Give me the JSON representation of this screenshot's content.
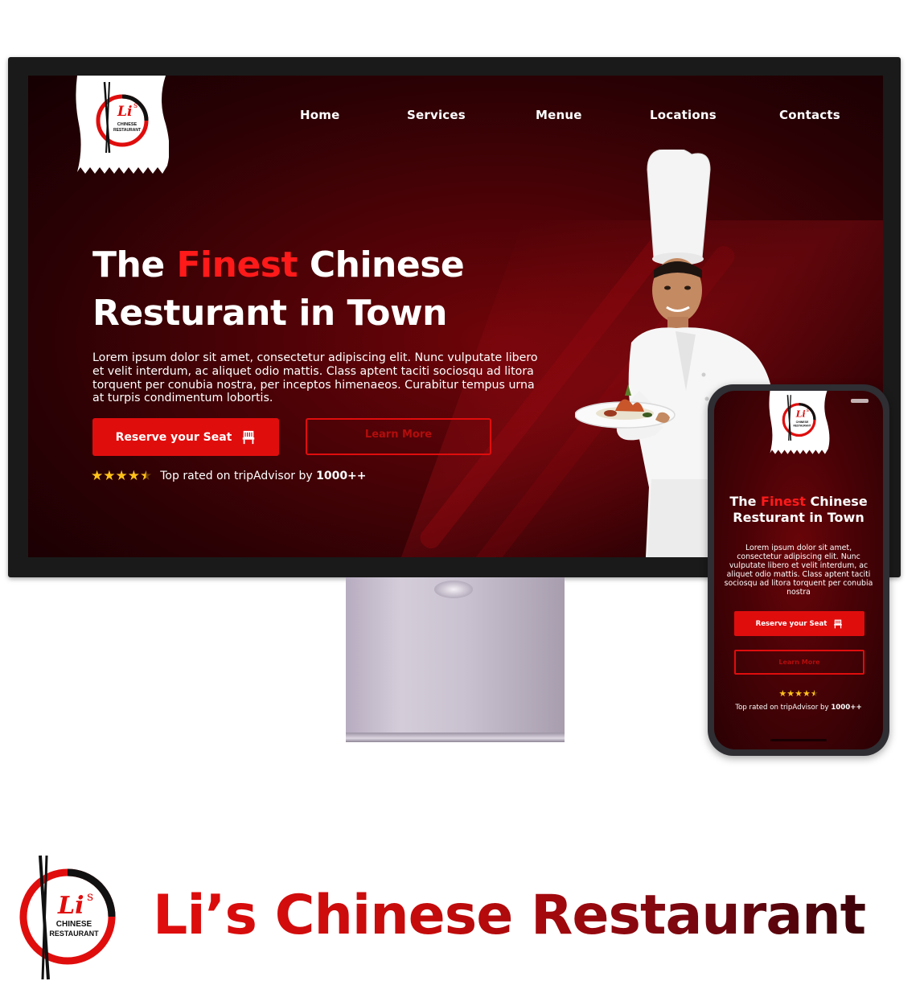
{
  "colors": {
    "accent": "#e00d0d",
    "bg_dark": "#2a0104",
    "bg_mid": "#6e0409",
    "star": "#ffc21a"
  },
  "logo": {
    "initials": "Li",
    "apostrophe": "'s",
    "line1": "CHINESE",
    "line2": "RESTAURANT"
  },
  "nav": {
    "items": [
      "Home",
      "Services",
      "Menue",
      "Locations",
      "Contacts"
    ]
  },
  "hero": {
    "title_prefix": "The ",
    "title_highlight": "Finest",
    "title_line1_suffix": " Chinese",
    "title_line2": "Resturant in Town",
    "description": "Lorem ipsum dolor sit amet, consectetur adipiscing elit. Nunc vulputate libero et velit interdum, ac aliquet odio mattis. Class aptent taciti sociosqu ad litora torquent per conubia nostra, per inceptos himenaeos. Curabitur tempus urna at turpis condimentum lobortis.",
    "primary_button": "Reserve your Seat",
    "secondary_button": "Learn More",
    "rating_text": "Top rated on tripAdvisor by ",
    "rating_count": "1000++",
    "rating_stars": 4.5
  },
  "mobile": {
    "title_prefix": "The ",
    "title_highlight": "Finest",
    "title_line1_suffix": " Chinese",
    "title_line2": "Resturant in Town",
    "description": "Lorem ipsum dolor sit amet, consectetur adipiscing elit. Nunc vulputate libero et velit interdum, ac aliquet odio mattis. Class aptent taciti sociosqu ad litora torquent per conubia nostra",
    "primary_button": "Reserve your Seat",
    "secondary_button": "Learn More",
    "rating_text": "Top rated on tripAdvisor by ",
    "rating_count": "1000++"
  },
  "brand": {
    "name": "Li’s Chinese Restaurant"
  }
}
